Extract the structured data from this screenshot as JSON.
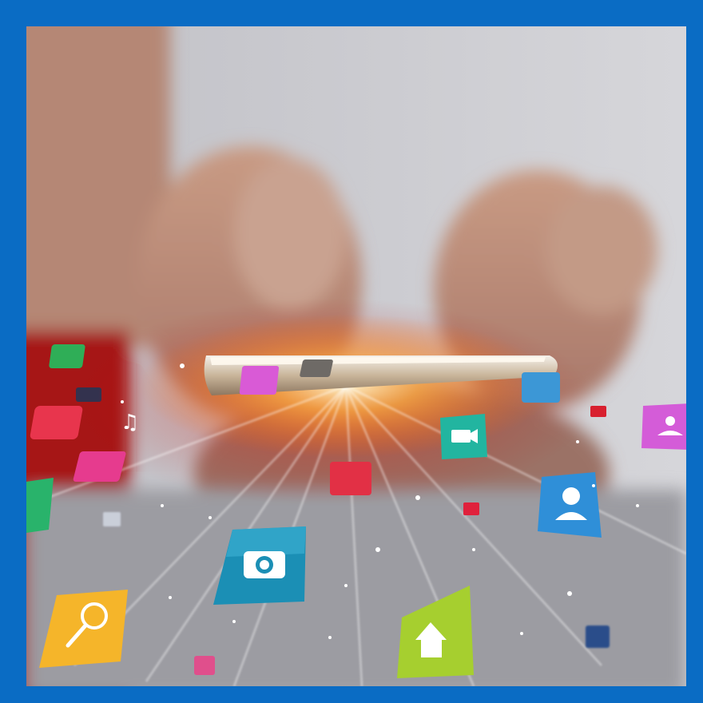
{
  "image": {
    "scene": "hands-holding-smartphone-with-flying-app-icons",
    "frame_color": "#0a6cc4",
    "icons": [
      {
        "name": "music-note-icon",
        "color": "#e8354d"
      },
      {
        "name": "camera-icon",
        "color": "#1b8fb5"
      },
      {
        "name": "search-icon",
        "color": "#f5b52a"
      },
      {
        "name": "home-icon",
        "color": "#a6cf2f"
      },
      {
        "name": "contact-icon",
        "color": "#2f8fd8"
      },
      {
        "name": "video-camera-icon",
        "color": "#22b5a0"
      },
      {
        "name": "chat-icon",
        "color": "#d45cd8"
      }
    ]
  }
}
